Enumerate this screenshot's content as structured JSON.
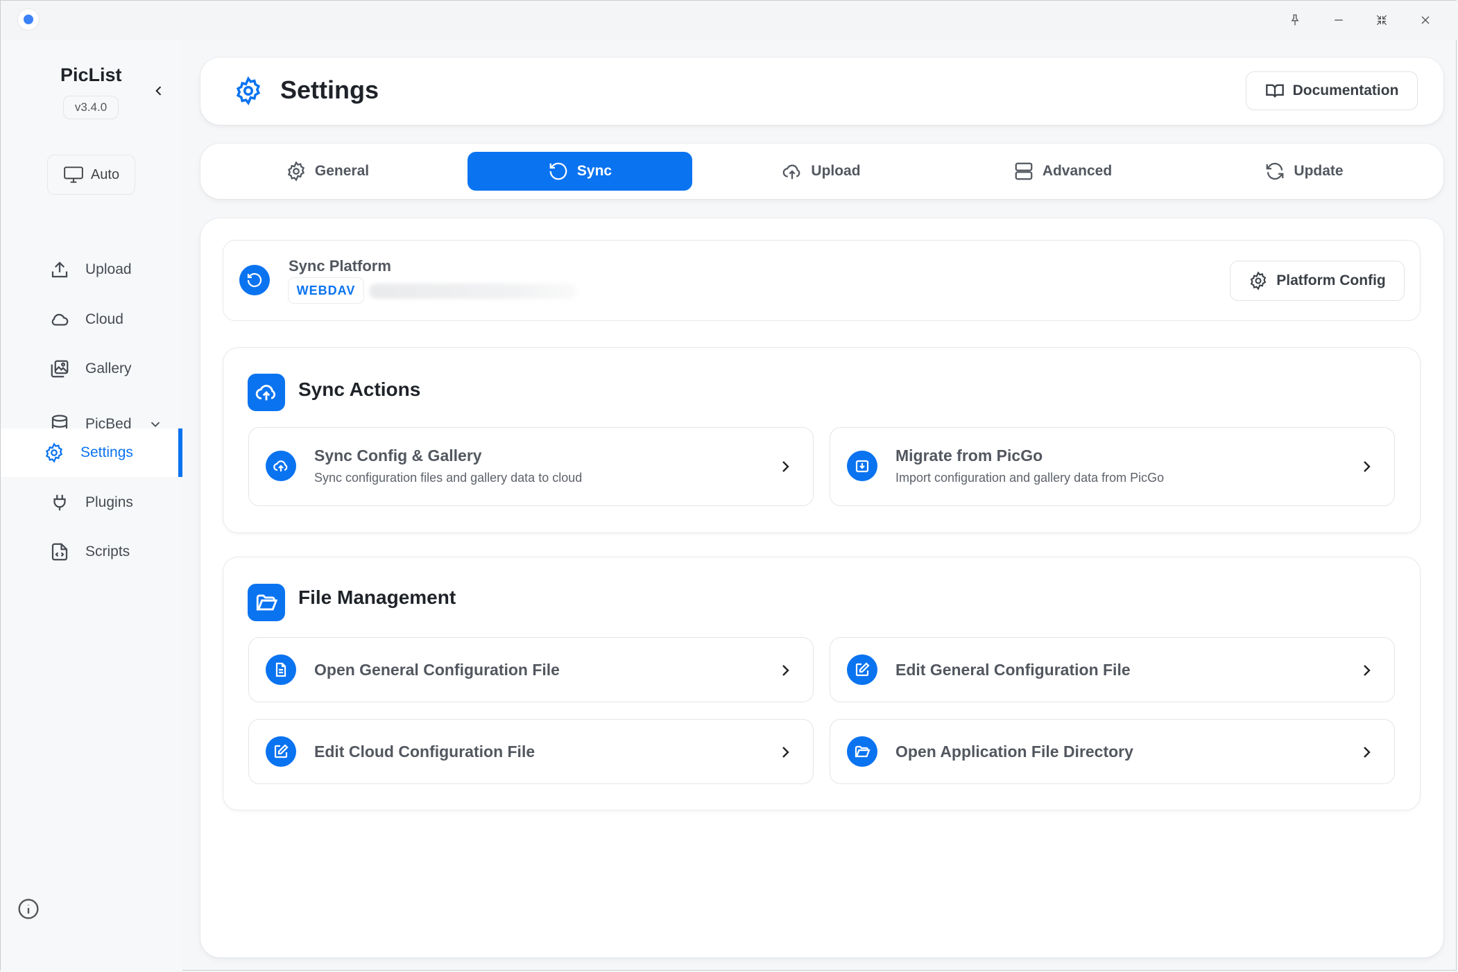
{
  "app": {
    "name": "PicList",
    "version": "v3.4.0"
  },
  "sidebar": {
    "theme_label": "Auto",
    "items": [
      {
        "label": "Upload",
        "icon": "upload-icon"
      },
      {
        "label": "Cloud",
        "icon": "cloud-icon"
      },
      {
        "label": "Gallery",
        "icon": "gallery-icon"
      },
      {
        "label": "PicBed",
        "icon": "database-icon"
      },
      {
        "label": "Settings",
        "icon": "gear-icon",
        "active": true
      },
      {
        "label": "Plugins",
        "icon": "plug-icon"
      },
      {
        "label": "Scripts",
        "icon": "script-file-icon"
      }
    ]
  },
  "header": {
    "title": "Settings",
    "doc_label": "Documentation"
  },
  "tabs": [
    {
      "label": "General",
      "icon": "gear-icon"
    },
    {
      "label": "Sync",
      "icon": "rotate-icon",
      "active": true
    },
    {
      "label": "Upload",
      "icon": "cloud-upload-icon"
    },
    {
      "label": "Advanced",
      "icon": "server-icon"
    },
    {
      "label": "Update",
      "icon": "refresh-icon"
    }
  ],
  "platform": {
    "title": "Sync Platform",
    "badge": "WEBDAV",
    "config_label": "Platform Config"
  },
  "sync_actions": {
    "title": "Sync Actions",
    "items": [
      {
        "title": "Sync Config & Gallery",
        "desc": "Sync configuration files and gallery data to cloud"
      },
      {
        "title": "Migrate from PicGo",
        "desc": "Import configuration and gallery data from PicGo"
      }
    ]
  },
  "file_management": {
    "title": "File Management",
    "items": [
      {
        "title": "Open General Configuration File"
      },
      {
        "title": "Edit General Configuration File"
      },
      {
        "title": "Edit Cloud Configuration File"
      },
      {
        "title": "Open Application File Directory"
      }
    ]
  },
  "colors": {
    "accent": "#0a73f0",
    "background": "#f6f7f9"
  }
}
